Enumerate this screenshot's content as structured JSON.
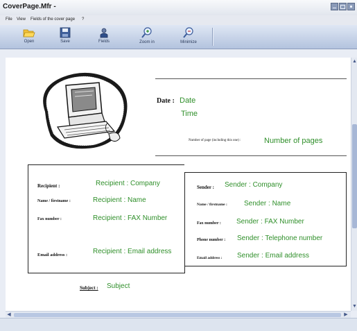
{
  "window": {
    "title": "CoverPage.Mfr -"
  },
  "menu": {
    "items": [
      "File",
      "View",
      "Fields of the cover page",
      "?"
    ]
  },
  "toolbar": {
    "open": "Open",
    "save": "Save",
    "fields": "Fields",
    "zoom_in": "Zoom in",
    "minimize": "Minimize"
  },
  "header": {
    "date_label": "Date :",
    "date_value": "Date",
    "time_value": "Time",
    "pages_label": "Number of page (including this one) :",
    "pages_value": "Number of pages"
  },
  "recipient": {
    "company_label": "Recipient :",
    "company_value": "Recipient : Company",
    "name_label": "Name / firstname :",
    "name_value": "Recipient : Name",
    "fax_label": "Fax number :",
    "fax_value": "Recipient : FAX Number",
    "email_label": "Email address :",
    "email_value": "Recipient : Email address"
  },
  "sender": {
    "company_label": "Sender :",
    "company_value": "Sender : Company",
    "name_label": "Name / firstname :",
    "name_value": "Sender : Name",
    "fax_label": "Fax number :",
    "fax_value": "Sender : FAX Number",
    "phone_label": "Phone number :",
    "phone_value": "Sender : Telephone number",
    "email_label": "Email address :",
    "email_value": "Sender : Email address"
  },
  "subject": {
    "label": "Subject :",
    "value": "Subject"
  },
  "colors": {
    "field_green": "#2f8f2a",
    "toolbar_blue": "#b3c3de"
  },
  "icons": [
    "folder-open-icon",
    "floppy-disk-icon",
    "fields-icon",
    "zoom-in-icon",
    "zoom-out-icon",
    "computer-clipart"
  ]
}
